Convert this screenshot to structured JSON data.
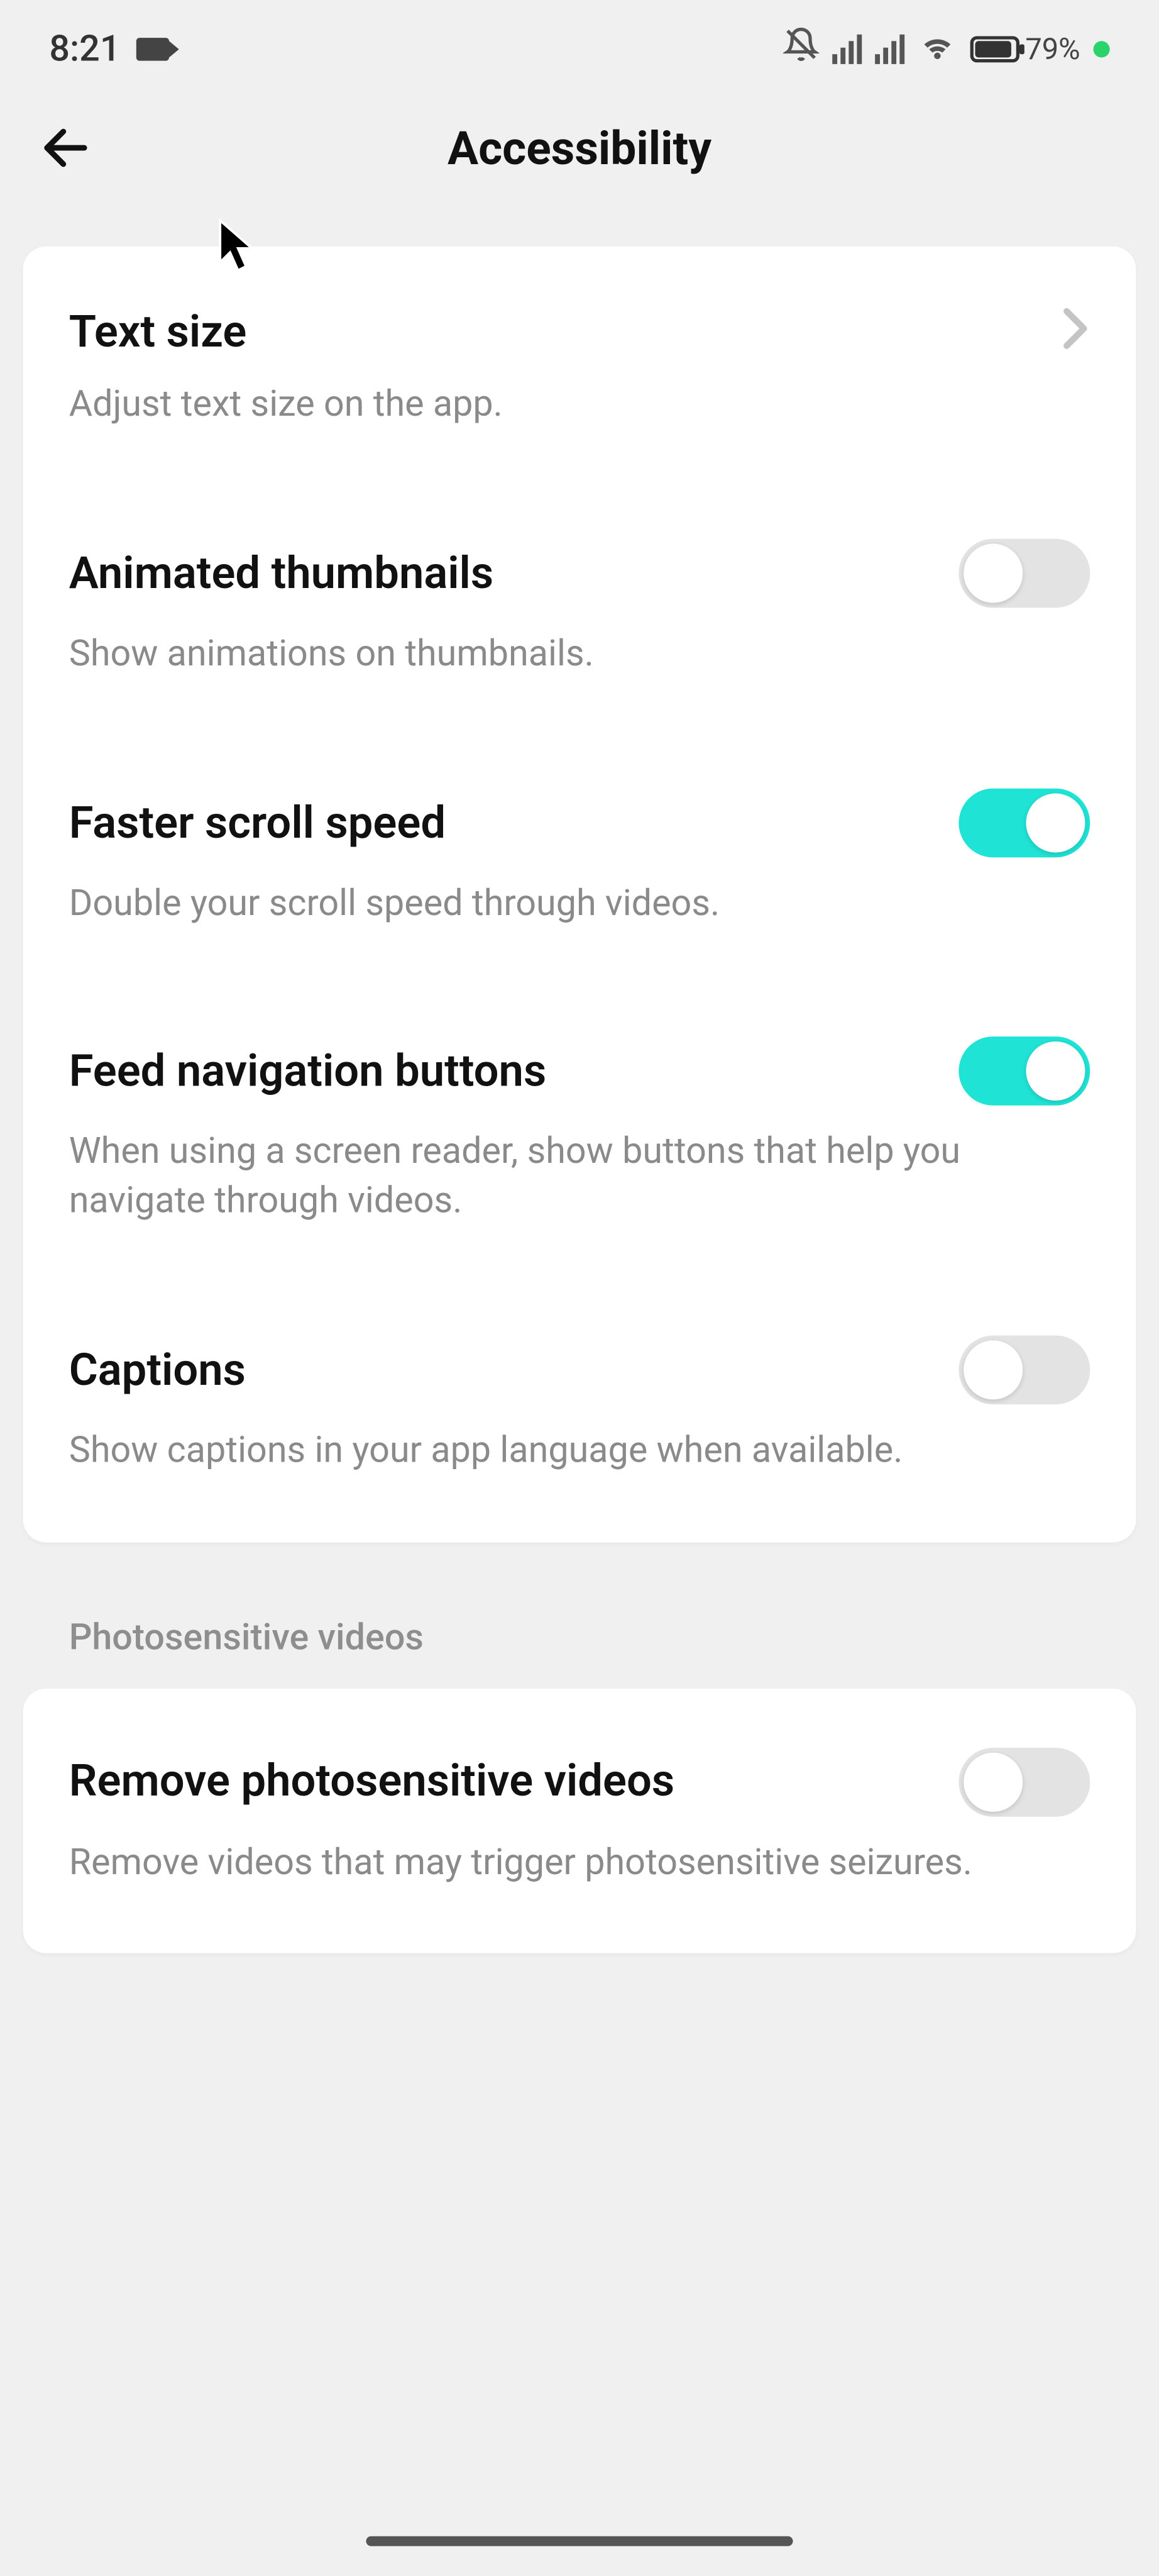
{
  "status": {
    "time": "8:21",
    "battery_pct": "79%"
  },
  "header": {
    "title": "Accessibility"
  },
  "settings": {
    "text_size": {
      "title": "Text size",
      "desc": "Adjust text size on the app."
    },
    "animated_thumbnails": {
      "title": "Animated thumbnails",
      "desc": "Show animations on thumbnails.",
      "enabled": false
    },
    "faster_scroll": {
      "title": "Faster scroll speed",
      "desc": "Double your scroll speed through videos.",
      "enabled": true
    },
    "feed_nav": {
      "title": "Feed navigation buttons",
      "desc": "When using a screen reader, show buttons that help you navigate through videos.",
      "enabled": true
    },
    "captions": {
      "title": "Captions",
      "desc": "Show captions in your app language when available.",
      "enabled": false
    }
  },
  "section_photosensitive": {
    "label": "Photosensitive videos",
    "remove": {
      "title": "Remove photosensitive videos",
      "desc": "Remove videos that may trigger photosensitive seizures.",
      "enabled": false
    }
  }
}
